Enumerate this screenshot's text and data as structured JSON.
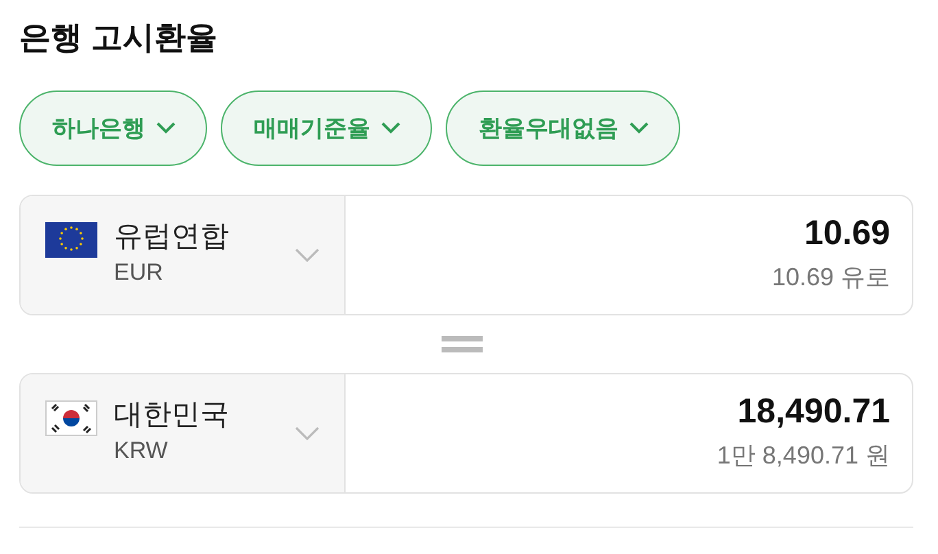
{
  "title": "은행 고시환율",
  "filters": [
    {
      "label": "하나은행"
    },
    {
      "label": "매매기준율"
    },
    {
      "label": "환율우대없음"
    }
  ],
  "currencies": [
    {
      "kind": "eu",
      "country": "유럽연합",
      "code": "EUR",
      "amount": "10.69",
      "amount_words": "10.69 유로"
    },
    {
      "kind": "kr",
      "country": "대한민국",
      "code": "KRW",
      "amount": "18,490.71",
      "amount_words": "1만 8,490.71 원"
    }
  ]
}
